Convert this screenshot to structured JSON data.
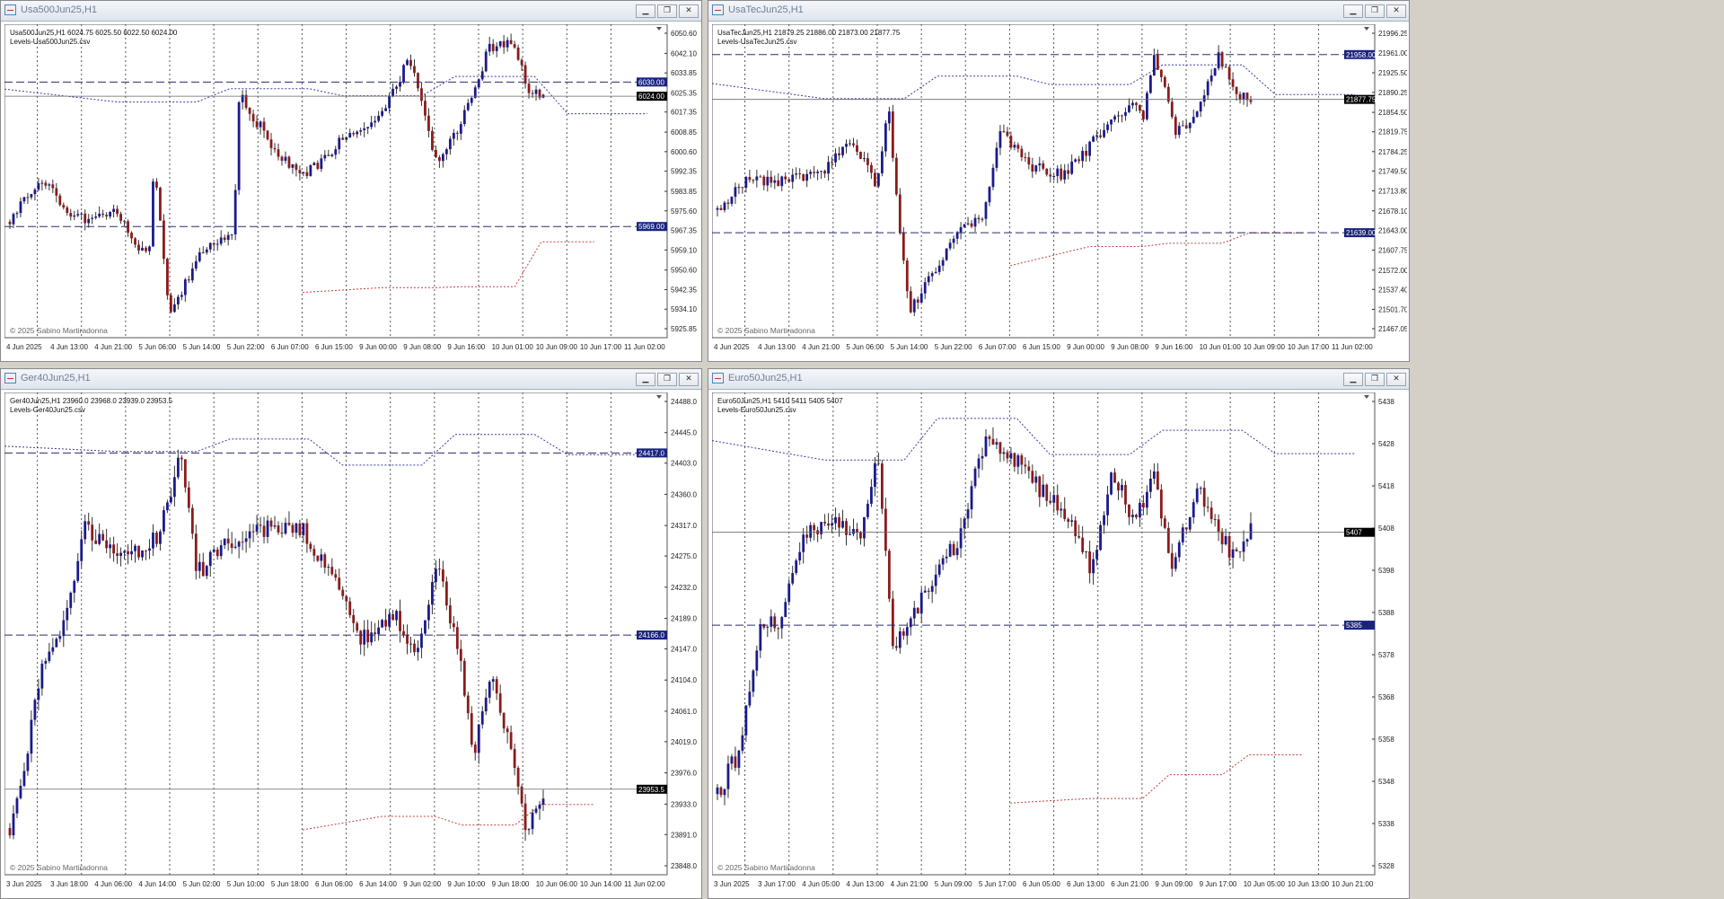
{
  "copyright": "© 2025 Sabino Martiradonna",
  "windows": [
    {
      "title": "Usa500Jun25,H1",
      "info_line": "Usa500Jun25,H1  6024.75 6025.50 6022.50 6024.00",
      "levels_label": "Levels-Usa500Jun25.csv",
      "price_labels": [
        "6050.60",
        "6042.10",
        "6033.85",
        "6025.35",
        "6017.35",
        "6008.85",
        "6000.60",
        "5992.35",
        "5983.85",
        "5975.60",
        "5967.35",
        "5959.10",
        "5950.60",
        "5942.35",
        "5934.10",
        "5925.85"
      ],
      "x_labels": [
        "4 Jun 2025",
        "4 Jun 13:00",
        "4 Jun 21:00",
        "5 Jun 06:00",
        "5 Jun 14:00",
        "5 Jun 22:00",
        "6 Jun 07:00",
        "6 Jun 15:00",
        "9 Jun 00:00",
        "9 Jun 08:00",
        "9 Jun 16:00",
        "10 Jun 01:00",
        "10 Jun 09:00",
        "10 Jun 17:00",
        "11 Jun 02:00"
      ],
      "levels": [
        {
          "label": "6030.00",
          "value": 6030.0
        },
        {
          "label": "5969.00",
          "value": 5969.0
        }
      ],
      "current": {
        "label": "6024.00",
        "value": 6024.0
      }
    },
    {
      "title": "UsaTecJun25,H1",
      "info_line": "UsaTecJun25,H1  21879.25 21886.00 21873.00 21877.75",
      "levels_label": "Levels-UsaTecJun25.csv",
      "price_labels": [
        "21996.25",
        "21961.00",
        "21925.50",
        "21890.25",
        "21854.50",
        "21819.75",
        "21784.25",
        "21749.50",
        "21713.80",
        "21678.10",
        "21643.00",
        "21607.75",
        "21572.00",
        "21537.40",
        "21501.70",
        "21467.05"
      ],
      "x_labels": [
        "4 Jun 2025",
        "4 Jun 13:00",
        "4 Jun 21:00",
        "5 Jun 06:00",
        "5 Jun 14:00",
        "5 Jun 22:00",
        "6 Jun 07:00",
        "6 Jun 15:00",
        "9 Jun 00:00",
        "9 Jun 08:00",
        "9 Jun 16:00",
        "10 Jun 01:00",
        "10 Jun 09:00",
        "10 Jun 17:00",
        "11 Jun 02:00"
      ],
      "levels": [
        {
          "label": "21958.00",
          "value": 21958.0
        },
        {
          "label": "21639.00",
          "value": 21639.0
        }
      ],
      "current": {
        "label": "21877.75",
        "value": 21877.75
      }
    },
    {
      "title": "Ger40Jun25,H1",
      "info_line": "Ger40Jun25,H1  23960.0 23968.0 23939.0 23953.5",
      "levels_label": "Levels-Ger40Jun25.csv",
      "price_labels": [
        "24488.0",
        "24445.0",
        "24403.0",
        "24360.0",
        "24317.0",
        "24275.0",
        "24232.0",
        "24189.0",
        "24147.0",
        "24104.0",
        "24061.0",
        "24019.0",
        "23976.0",
        "23933.0",
        "23891.0",
        "23848.0"
      ],
      "x_labels": [
        "3 Jun 2025",
        "3 Jun 18:00",
        "4 Jun 06:00",
        "4 Jun 14:00",
        "5 Jun 02:00",
        "5 Jun 10:00",
        "5 Jun 18:00",
        "6 Jun 06:00",
        "6 Jun 14:00",
        "9 Jun 02:00",
        "9 Jun 10:00",
        "9 Jun 18:00",
        "10 Jun 06:00",
        "10 Jun 14:00",
        "11 Jun 02:00"
      ],
      "levels": [
        {
          "label": "24417.0",
          "value": 24417.0
        },
        {
          "label": "24166.0",
          "value": 24166.0
        }
      ],
      "current": {
        "label": "23953.5",
        "value": 23953.5
      }
    },
    {
      "title": "Euro50Jun25,H1",
      "info_line": "Euro50Jun25,H1  5410 5411 5405 5407",
      "levels_label": "Levels-Euro50Jun25.csv",
      "price_labels": [
        "5438",
        "5428",
        "5418",
        "5408",
        "5398",
        "5388",
        "5378",
        "5368",
        "5358",
        "5348",
        "5338",
        "5328"
      ],
      "x_labels": [
        "3 Jun 2025",
        "3 Jun 17:00",
        "4 Jun 05:00",
        "4 Jun 13:00",
        "4 Jun 21:00",
        "5 Jun 09:00",
        "5 Jun 17:00",
        "6 Jun 05:00",
        "6 Jun 13:00",
        "6 Jun 21:00",
        "9 Jun 09:00",
        "9 Jun 17:00",
        "10 Jun 05:00",
        "10 Jun 13:00",
        "10 Jun 21:00"
      ],
      "levels": [
        {
          "label": "5385",
          "value": 5385.0
        }
      ],
      "current": {
        "label": "5407",
        "value": 5407.0
      }
    }
  ],
  "colors": {
    "bull": "#1a1a8c",
    "bear": "#8b1a1a",
    "level": "#2b2b6b",
    "current_bg": "#000000",
    "level_bg": "#1a237e",
    "resist": "#3a3aa0",
    "support": "#c04040"
  },
  "icons": {
    "minimize": "minimize-icon",
    "restore": "restore-icon",
    "close": "close-icon",
    "window": "chart-window-icon"
  }
}
